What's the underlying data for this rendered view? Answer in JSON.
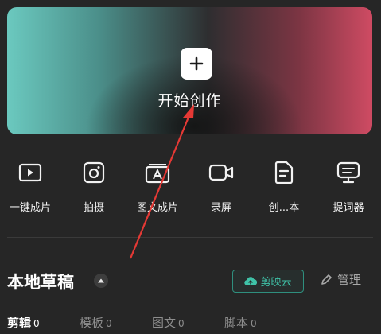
{
  "hero": {
    "label": "开始创作"
  },
  "tools": [
    {
      "label": "一键成片",
      "icon": "play-icon"
    },
    {
      "label": "拍摄",
      "icon": "camera-icon"
    },
    {
      "label": "图文成片",
      "icon": "text-image-icon"
    },
    {
      "label": "录屏",
      "icon": "video-record-icon"
    },
    {
      "label": "创...本",
      "icon": "script-icon"
    },
    {
      "label": "提词器",
      "icon": "teleprompter-icon"
    }
  ],
  "section": {
    "title": "本地草稿",
    "cloud_label": "剪映云",
    "manage_label": "管理"
  },
  "tabs": [
    {
      "label": "剪辑",
      "count": "0"
    },
    {
      "label": "模板",
      "count": "0"
    },
    {
      "label": "图文",
      "count": "0"
    },
    {
      "label": "脚本",
      "count": "0"
    }
  ],
  "colors": {
    "accent": "#3fc3a8",
    "annotation_arrow": "#e53935",
    "background": "#262626"
  }
}
